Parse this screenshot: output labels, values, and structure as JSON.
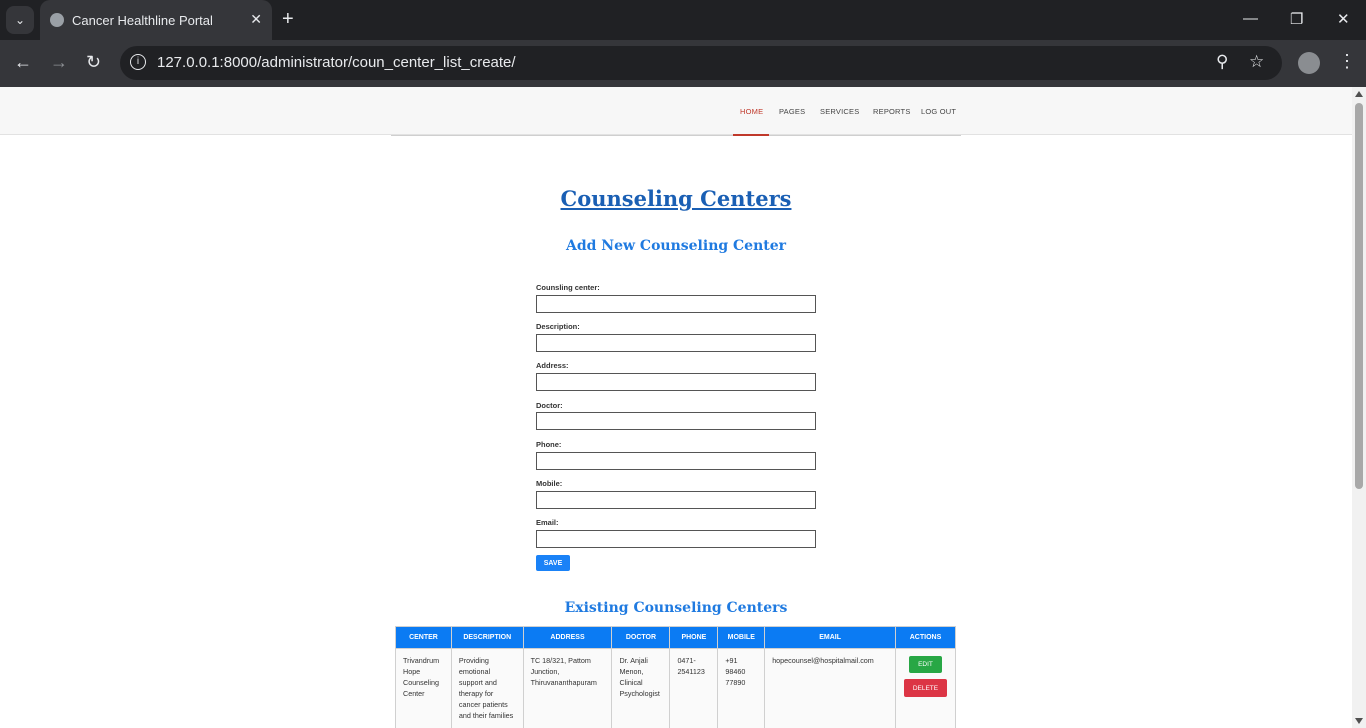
{
  "browser": {
    "tab_title": "Cancer Healthline Portal",
    "url": "127.0.0.1:8000/administrator/coun_center_list_create/"
  },
  "nav": {
    "home": "HOME",
    "pages": "PAGES",
    "services": "SERVICES",
    "reports": "REPORTS",
    "logout": "LOG OUT"
  },
  "page": {
    "title": "Counseling Centers",
    "form_heading": "Add New Counseling Center",
    "list_heading": "Existing Counseling Centers"
  },
  "form": {
    "center_label": "Counsling center:",
    "description_label": "Description:",
    "address_label": "Address:",
    "doctor_label": "Doctor:",
    "phone_label": "Phone:",
    "mobile_label": "Mobile:",
    "email_label": "Email:",
    "save_label": "SAVE"
  },
  "table": {
    "headers": [
      "CENTER",
      "DESCRIPTION",
      "ADDRESS",
      "DOCTOR",
      "PHONE",
      "MOBILE",
      "EMAIL",
      "ACTIONS"
    ],
    "rows": [
      {
        "center": "Trivandrum Hope Counseling Center",
        "description": "Providing emotional support and therapy for cancer patients and their families",
        "address": "TC 18/321, Pattom Junction, Thiruvananthapuram",
        "doctor": "Dr. Anjali Menon, Clinical Psychologist",
        "phone": "0471-2541123",
        "mobile": "+91 98460 77890",
        "email": "hopecounsel@hospitalmail.com",
        "edit_label": "EDIT",
        "delete_label": "DELETE"
      }
    ]
  }
}
